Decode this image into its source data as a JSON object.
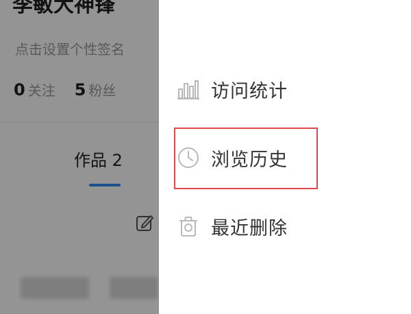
{
  "profile": {
    "name": "李敏大神锋",
    "bio": "点击设置个性签名",
    "stats": [
      {
        "num": "0",
        "label": "关注"
      },
      {
        "num": "5",
        "label": "粉丝"
      }
    ],
    "tab_label": "作品 2",
    "edit_icon": "edit-icon"
  },
  "drawer": {
    "items": [
      {
        "label": "访问统计",
        "icon": "bar-chart-icon"
      },
      {
        "label": "浏览历史",
        "icon": "clock-icon"
      },
      {
        "label": "最近删除",
        "icon": "trash-icon"
      }
    ]
  },
  "colors": {
    "overlay": "rgba(0,0,0,0.42)",
    "highlight": "#e0474c",
    "accent": "#2d8cf0",
    "icon": "#b8b8b8",
    "text": "#333333"
  }
}
